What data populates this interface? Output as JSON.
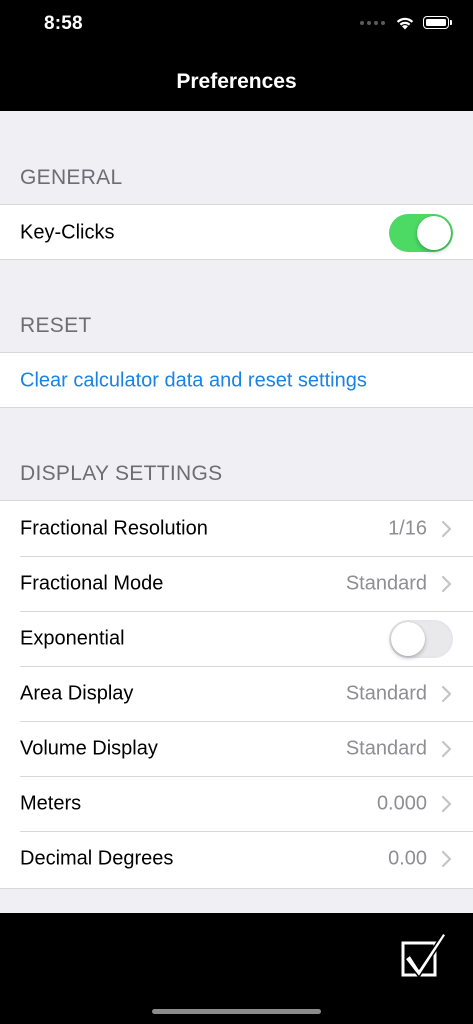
{
  "status_bar": {
    "time": "8:58"
  },
  "nav": {
    "title": "Preferences"
  },
  "sections": {
    "general": {
      "header": "GENERAL",
      "key_clicks": {
        "label": "Key-Clicks",
        "enabled": true
      }
    },
    "reset": {
      "header": "RESET",
      "clear_link": "Clear calculator data and reset settings"
    },
    "display": {
      "header": "DISPLAY SETTINGS",
      "fractional_resolution": {
        "label": "Fractional Resolution",
        "value": "1/16"
      },
      "fractional_mode": {
        "label": "Fractional Mode",
        "value": "Standard"
      },
      "exponential": {
        "label": "Exponential",
        "enabled": false
      },
      "area_display": {
        "label": "Area Display",
        "value": "Standard"
      },
      "volume_display": {
        "label": "Volume Display",
        "value": "Standard"
      },
      "meters": {
        "label": "Meters",
        "value": "0.000"
      },
      "decimal_degrees": {
        "label": "Decimal Degrees",
        "value": "0.00"
      }
    }
  },
  "colors": {
    "toggle_on": "#4cd964",
    "link": "#1a82e3",
    "secondary_text": "#8e8e93",
    "background": "#efeff4"
  },
  "icons": {
    "row_chevron": "chevron-right-icon",
    "done": "checkbox-check-icon"
  }
}
